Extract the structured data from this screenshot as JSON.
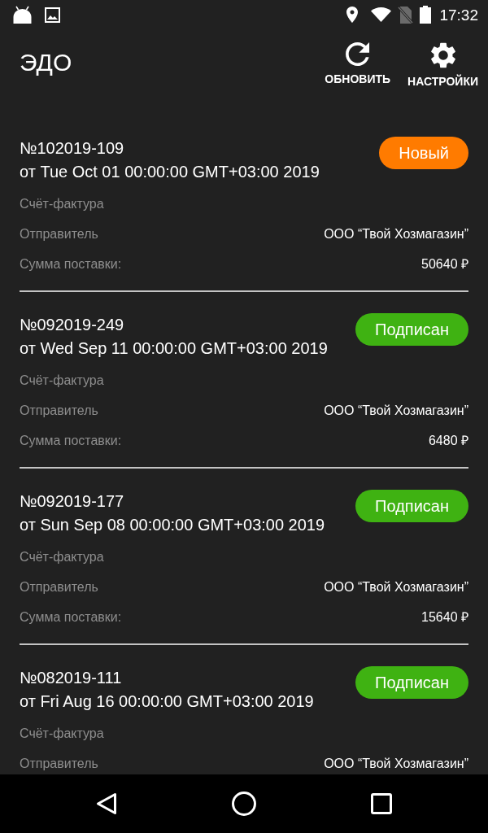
{
  "status_bar": {
    "time": "17:32"
  },
  "app_bar": {
    "title": "ЭДО",
    "actions": [
      {
        "label": "ОБНОВИТЬ"
      },
      {
        "label": "НАСТРОЙКИ"
      }
    ]
  },
  "documents": [
    {
      "number": "№102019-109",
      "date": "от Tue Oct 01 00:00:00 GMT+03:00 2019",
      "status": {
        "label": "Новый",
        "kind": "new"
      },
      "type": "Счёт-фактура",
      "fields": [
        {
          "label": "Отправитель",
          "value": "ООО “Твой Хозмагазин”"
        },
        {
          "label": "Сумма поставки:",
          "value": "50640 ₽"
        }
      ]
    },
    {
      "number": "№092019-249",
      "date": "от Wed Sep 11 00:00:00 GMT+03:00 2019",
      "status": {
        "label": "Подписан",
        "kind": "signed"
      },
      "type": "Счёт-фактура",
      "fields": [
        {
          "label": "Отправитель",
          "value": "ООО “Твой Хозмагазин”"
        },
        {
          "label": "Сумма поставки:",
          "value": "6480 ₽"
        }
      ]
    },
    {
      "number": "№092019-177",
      "date": "от Sun Sep 08 00:00:00 GMT+03:00 2019",
      "status": {
        "label": "Подписан",
        "kind": "signed"
      },
      "type": "Счёт-фактура",
      "fields": [
        {
          "label": "Отправитель",
          "value": "ООО “Твой Хозмагазин”"
        },
        {
          "label": "Сумма поставки:",
          "value": "15640 ₽"
        }
      ]
    },
    {
      "number": "№082019-111",
      "date": "от Fri Aug 16 00:00:00 GMT+03:00 2019",
      "status": {
        "label": "Подписан",
        "kind": "signed"
      },
      "type": "Счёт-фактура",
      "fields": [
        {
          "label": "Отправитель",
          "value": "ООО “Твой Хозмагазин”"
        }
      ]
    }
  ]
}
